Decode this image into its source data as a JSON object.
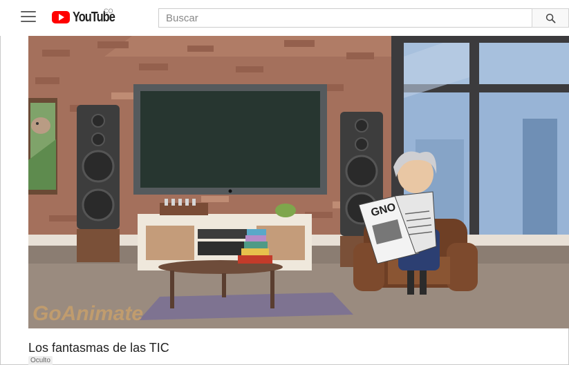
{
  "header": {
    "logo_text": "YouTube",
    "logo_country": "CO",
    "search_placeholder": "Buscar"
  },
  "video": {
    "newspaper_headline": "GNO",
    "watermark": "GoAnimate"
  },
  "title": "Los fantasmas de las TIC",
  "status_badge": "Oculto",
  "colors": {
    "brand": "#ff0000",
    "wall": "#a4705c",
    "floor": "#8b7d72"
  }
}
